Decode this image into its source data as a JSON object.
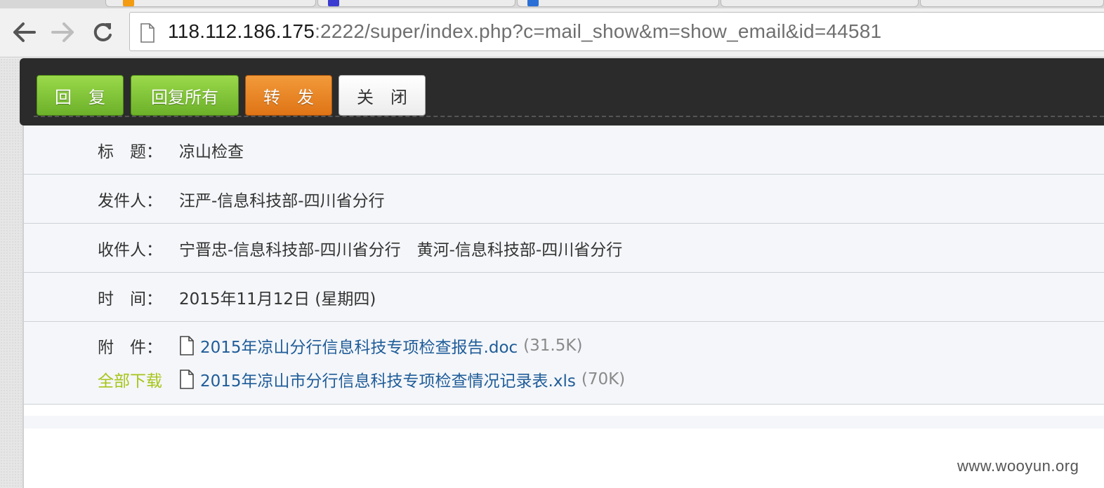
{
  "browser": {
    "url_host": "118.112.186.175",
    "url_rest": ":2222/super/index.php?c=mail_show&m=show_email&id=44581"
  },
  "actions": {
    "reply": "回　复",
    "reply_all": "回复所有",
    "forward": "转　发",
    "close": "关　闭"
  },
  "mail": {
    "subject_label": "标　题：",
    "subject": "凉山检查",
    "sender_label": "发件人：",
    "sender": "汪严-信息科技部-四川省分行",
    "recipients_label": "收件人：",
    "recipients": "宁晋忠-信息科技部-四川省分行　黄河-信息科技部-四川省分行",
    "time_label": "时　间：",
    "time": "2015年11月12日 (星期四)",
    "attachments_label": "附　件：",
    "download_all": "全部下载",
    "attachments": [
      {
        "name": "2015年凉山分行信息科技专项检查报告.doc",
        "size": "(31.5K)"
      },
      {
        "name": "2015年凉山市分行信息科技专项检查情况记录表.xls",
        "size": "(70K)"
      }
    ]
  },
  "watermark": "www.wooyun.org",
  "colors": {
    "green_button": "#7cc132",
    "orange_button": "#e8841f",
    "link": "#1f5c99",
    "download_all": "#a6c51a"
  }
}
